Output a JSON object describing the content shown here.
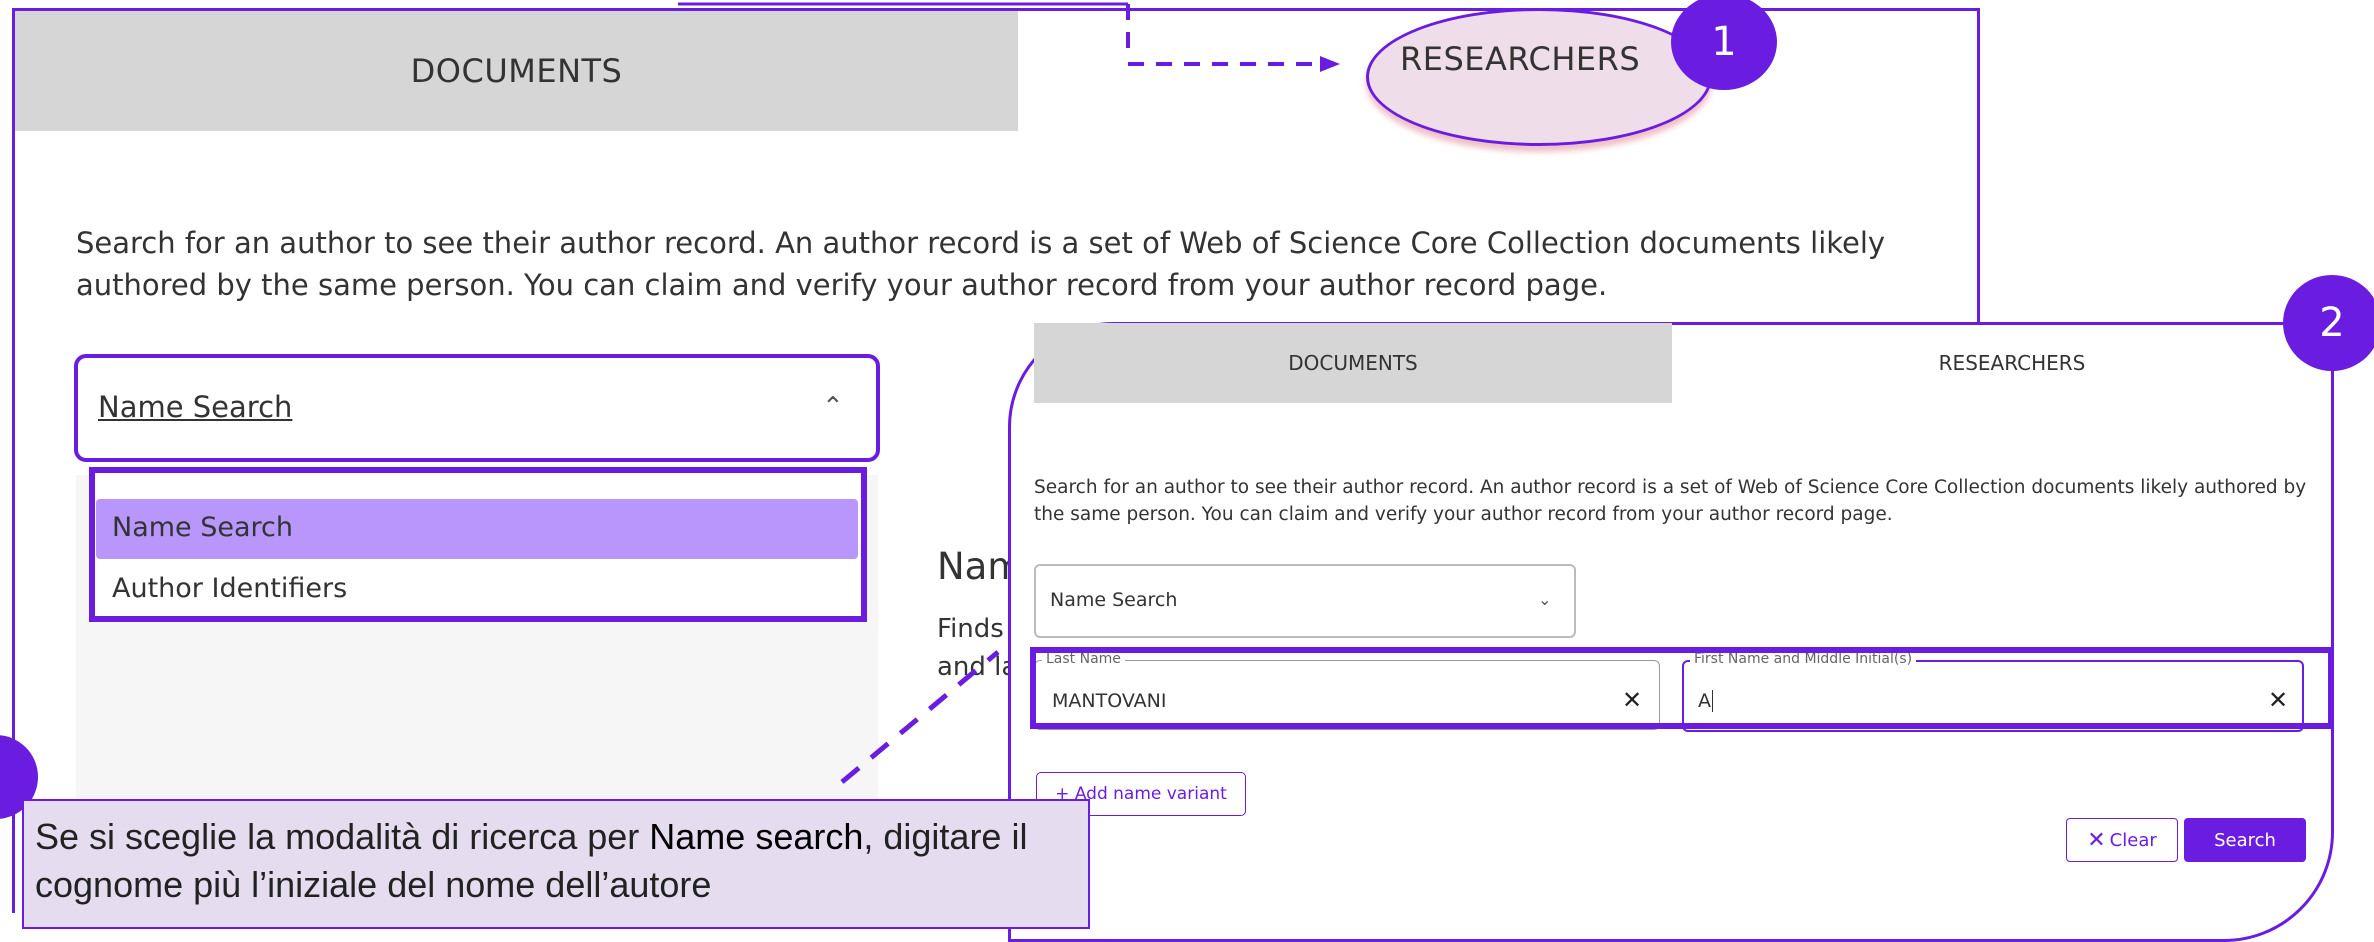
{
  "colors": {
    "accent": "#6a1de0",
    "tab_inactive_bg": "#d6d6d6",
    "dropdown_selected_bg": "#b896fb",
    "note_bg": "#e5dcef"
  },
  "back_panel": {
    "tabs": [
      "DOCUMENTS",
      "RESEARCHERS"
    ],
    "description": "Search for an author to see their author record. An author record is a set of Web of Science Core Collection documents likely authored by the same person. You can claim and verify your author record from your author record page.",
    "search_type": {
      "selected": "Name Search",
      "chevron": "chevron-up-icon"
    },
    "dropdown_options": [
      "Name Search",
      "Author Identifiers"
    ],
    "partial_heading": "Nam",
    "partial_text_line1": "Finds",
    "partial_text_line2": "and la"
  },
  "callouts": {
    "one": "1",
    "two": "2"
  },
  "front_panel": {
    "tabs": [
      "DOCUMENTS",
      "RESEARCHERS"
    ],
    "description": "Search for an author to see their author record. An author record is a set of Web of Science Core Collection documents likely authored by the same person. You can claim and verify your author record from your author record page.",
    "search_type": {
      "selected": "Name Search",
      "chevron": "chevron-down-icon"
    },
    "last_name": {
      "label": "Last Name",
      "value": "MANTOVANI"
    },
    "first_name": {
      "label": "First Name and Middle Initial(s)",
      "value": "A"
    },
    "add_variant_label": "+ Add name variant",
    "clear_label": "Clear",
    "search_label": "Search"
  },
  "note": {
    "before": "Se si sceglie la modalità di ricerca per ",
    "emphasis": "Name search",
    "after": ", digitare il cognome più l’iniziale del nome dell’autore"
  }
}
